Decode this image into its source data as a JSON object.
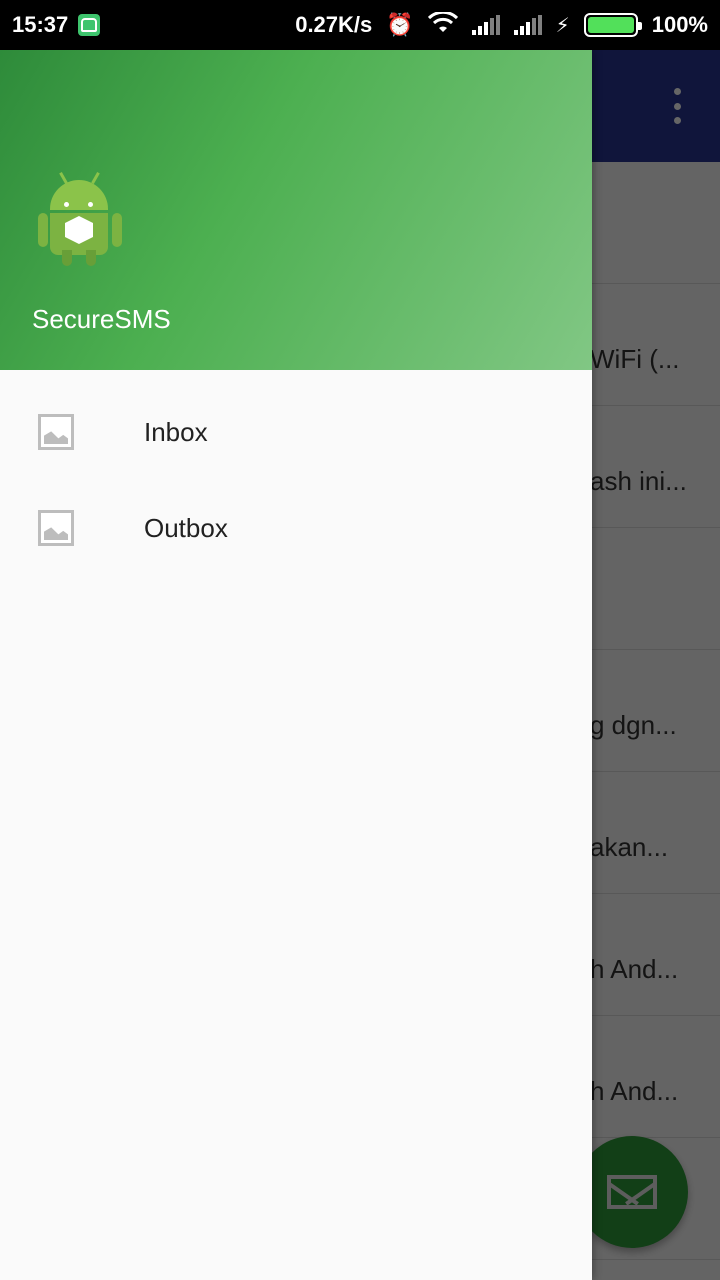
{
  "status_bar": {
    "time": "15:37",
    "network_speed": "0.27K/s",
    "battery": "100%",
    "battery_level": 1.0,
    "icons": [
      "notification-app-icon",
      "alarm-icon",
      "wifi-icon",
      "signal-icon",
      "signal-icon",
      "charging-icon",
      "battery-icon"
    ]
  },
  "drawer": {
    "header": {
      "app_name": "SecureSMS",
      "logo": "android-logo-icon"
    },
    "items": [
      {
        "label": "Inbox",
        "icon": "image-placeholder-icon"
      },
      {
        "label": "Outbox",
        "icon": "image-placeholder-icon"
      }
    ]
  },
  "background": {
    "toolbar_color": "#283593",
    "rows": [
      "",
      "WiFi (...",
      "ash ini...",
      "",
      "g dgn...",
      "akan...",
      "h And...",
      "h And...",
      ""
    ],
    "fab_icon": "mail-icon"
  },
  "colors": {
    "header_start": "#2e8b3a",
    "header_end": "#81c784",
    "fab": "#2e9e3a"
  }
}
